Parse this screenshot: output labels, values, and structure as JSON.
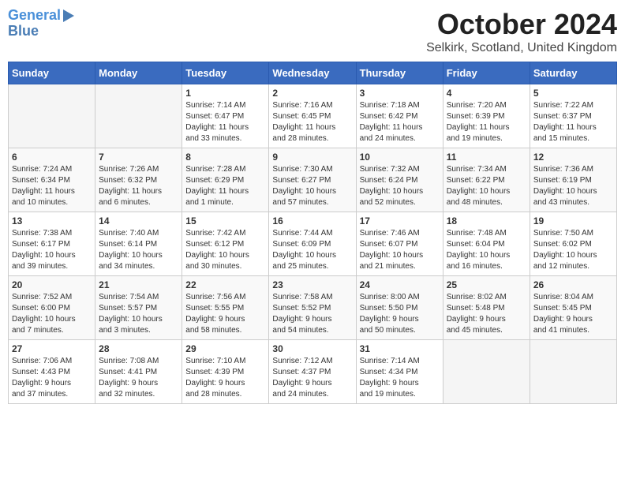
{
  "logo": {
    "line1": "General",
    "line2": "Blue"
  },
  "title": "October 2024",
  "location": "Selkirk, Scotland, United Kingdom",
  "days_of_week": [
    "Sunday",
    "Monday",
    "Tuesday",
    "Wednesday",
    "Thursday",
    "Friday",
    "Saturday"
  ],
  "weeks": [
    [
      {
        "num": "",
        "info": ""
      },
      {
        "num": "",
        "info": ""
      },
      {
        "num": "1",
        "info": "Sunrise: 7:14 AM\nSunset: 6:47 PM\nDaylight: 11 hours\nand 33 minutes."
      },
      {
        "num": "2",
        "info": "Sunrise: 7:16 AM\nSunset: 6:45 PM\nDaylight: 11 hours\nand 28 minutes."
      },
      {
        "num": "3",
        "info": "Sunrise: 7:18 AM\nSunset: 6:42 PM\nDaylight: 11 hours\nand 24 minutes."
      },
      {
        "num": "4",
        "info": "Sunrise: 7:20 AM\nSunset: 6:39 PM\nDaylight: 11 hours\nand 19 minutes."
      },
      {
        "num": "5",
        "info": "Sunrise: 7:22 AM\nSunset: 6:37 PM\nDaylight: 11 hours\nand 15 minutes."
      }
    ],
    [
      {
        "num": "6",
        "info": "Sunrise: 7:24 AM\nSunset: 6:34 PM\nDaylight: 11 hours\nand 10 minutes."
      },
      {
        "num": "7",
        "info": "Sunrise: 7:26 AM\nSunset: 6:32 PM\nDaylight: 11 hours\nand 6 minutes."
      },
      {
        "num": "8",
        "info": "Sunrise: 7:28 AM\nSunset: 6:29 PM\nDaylight: 11 hours\nand 1 minute."
      },
      {
        "num": "9",
        "info": "Sunrise: 7:30 AM\nSunset: 6:27 PM\nDaylight: 10 hours\nand 57 minutes."
      },
      {
        "num": "10",
        "info": "Sunrise: 7:32 AM\nSunset: 6:24 PM\nDaylight: 10 hours\nand 52 minutes."
      },
      {
        "num": "11",
        "info": "Sunrise: 7:34 AM\nSunset: 6:22 PM\nDaylight: 10 hours\nand 48 minutes."
      },
      {
        "num": "12",
        "info": "Sunrise: 7:36 AM\nSunset: 6:19 PM\nDaylight: 10 hours\nand 43 minutes."
      }
    ],
    [
      {
        "num": "13",
        "info": "Sunrise: 7:38 AM\nSunset: 6:17 PM\nDaylight: 10 hours\nand 39 minutes."
      },
      {
        "num": "14",
        "info": "Sunrise: 7:40 AM\nSunset: 6:14 PM\nDaylight: 10 hours\nand 34 minutes."
      },
      {
        "num": "15",
        "info": "Sunrise: 7:42 AM\nSunset: 6:12 PM\nDaylight: 10 hours\nand 30 minutes."
      },
      {
        "num": "16",
        "info": "Sunrise: 7:44 AM\nSunset: 6:09 PM\nDaylight: 10 hours\nand 25 minutes."
      },
      {
        "num": "17",
        "info": "Sunrise: 7:46 AM\nSunset: 6:07 PM\nDaylight: 10 hours\nand 21 minutes."
      },
      {
        "num": "18",
        "info": "Sunrise: 7:48 AM\nSunset: 6:04 PM\nDaylight: 10 hours\nand 16 minutes."
      },
      {
        "num": "19",
        "info": "Sunrise: 7:50 AM\nSunset: 6:02 PM\nDaylight: 10 hours\nand 12 minutes."
      }
    ],
    [
      {
        "num": "20",
        "info": "Sunrise: 7:52 AM\nSunset: 6:00 PM\nDaylight: 10 hours\nand 7 minutes."
      },
      {
        "num": "21",
        "info": "Sunrise: 7:54 AM\nSunset: 5:57 PM\nDaylight: 10 hours\nand 3 minutes."
      },
      {
        "num": "22",
        "info": "Sunrise: 7:56 AM\nSunset: 5:55 PM\nDaylight: 9 hours\nand 58 minutes."
      },
      {
        "num": "23",
        "info": "Sunrise: 7:58 AM\nSunset: 5:52 PM\nDaylight: 9 hours\nand 54 minutes."
      },
      {
        "num": "24",
        "info": "Sunrise: 8:00 AM\nSunset: 5:50 PM\nDaylight: 9 hours\nand 50 minutes."
      },
      {
        "num": "25",
        "info": "Sunrise: 8:02 AM\nSunset: 5:48 PM\nDaylight: 9 hours\nand 45 minutes."
      },
      {
        "num": "26",
        "info": "Sunrise: 8:04 AM\nSunset: 5:45 PM\nDaylight: 9 hours\nand 41 minutes."
      }
    ],
    [
      {
        "num": "27",
        "info": "Sunrise: 7:06 AM\nSunset: 4:43 PM\nDaylight: 9 hours\nand 37 minutes."
      },
      {
        "num": "28",
        "info": "Sunrise: 7:08 AM\nSunset: 4:41 PM\nDaylight: 9 hours\nand 32 minutes."
      },
      {
        "num": "29",
        "info": "Sunrise: 7:10 AM\nSunset: 4:39 PM\nDaylight: 9 hours\nand 28 minutes."
      },
      {
        "num": "30",
        "info": "Sunrise: 7:12 AM\nSunset: 4:37 PM\nDaylight: 9 hours\nand 24 minutes."
      },
      {
        "num": "31",
        "info": "Sunrise: 7:14 AM\nSunset: 4:34 PM\nDaylight: 9 hours\nand 19 minutes."
      },
      {
        "num": "",
        "info": ""
      },
      {
        "num": "",
        "info": ""
      }
    ]
  ]
}
